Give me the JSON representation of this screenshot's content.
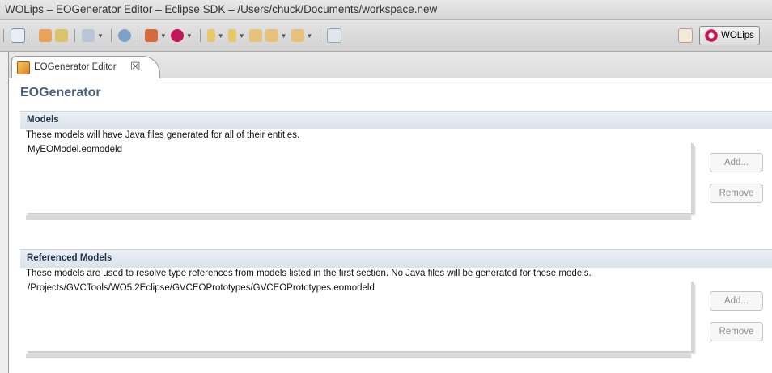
{
  "window": {
    "title": "WOLips – EOGenerator Editor – Eclipse SDK – /Users/chuck/Documents/workspace.new"
  },
  "toolbar": {
    "icons": [
      "new-icon",
      "open-icon",
      "run-icon",
      "debug-icon",
      "globe-icon",
      "wo-tool-icon",
      "wo-config-icon",
      "next-annotation-icon",
      "prev-annotation-icon",
      "back-icon",
      "history-back-icon",
      "forward-icon",
      "pin-icon"
    ],
    "perspective_label": "WOLips"
  },
  "editor_tab": {
    "label": "EOGenerator Editor",
    "close_symbol": "☒"
  },
  "form": {
    "title": "EOGenerator",
    "sections": [
      {
        "header": "Models",
        "description": "These models will have Java files generated for all of their entities.",
        "items": [
          "MyEOModel.eomodeld"
        ],
        "add_label": "Add...",
        "remove_label": "Remove"
      },
      {
        "header": "Referenced Models",
        "description": "These models are used to resolve type references from models listed in the first section.  No Java files will be generated for these models.",
        "items": [
          "/Projects/GVCTools/WO5.2Eclipse/GVCEOPrototypes/GVCEOPrototypes.eomodeld"
        ],
        "add_label": "Add...",
        "remove_label": "Remove"
      }
    ]
  },
  "colors": {
    "form_title": "#4a5f7a",
    "section_header_bg": "#dbe2ea",
    "button_text_disabled": "#8d8d8d"
  }
}
